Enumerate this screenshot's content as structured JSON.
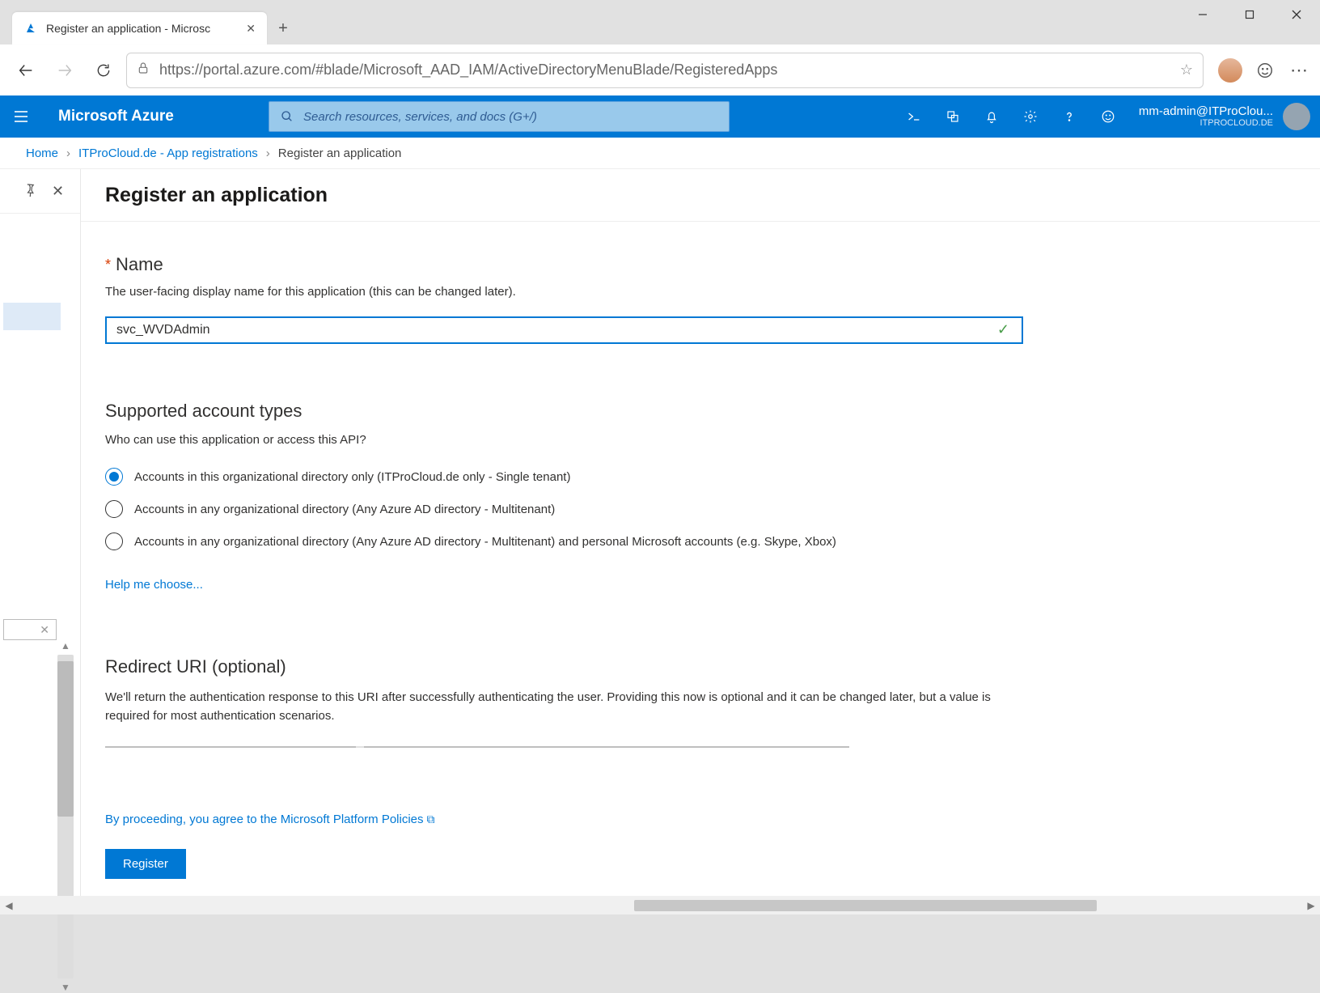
{
  "browser": {
    "tab_title": "Register an application - Microsc",
    "url": "https://portal.azure.com/#blade/Microsoft_AAD_IAM/ActiveDirectoryMenuBlade/RegisteredApps"
  },
  "azure": {
    "brand": "Microsoft Azure",
    "search_placeholder": "Search resources, services, and docs (G+/)",
    "user_line1": "mm-admin@ITProClou...",
    "user_line2": "ITPROCLOUD.DE"
  },
  "breadcrumb": {
    "items": [
      "Home",
      "ITProCloud.de - App registrations",
      "Register an application"
    ]
  },
  "page": {
    "title": "Register an application",
    "name_section": {
      "label": "Name",
      "desc": "The user-facing display name for this application (this can be changed later).",
      "value": "svc_WVDAdmin"
    },
    "account_types": {
      "label": "Supported account types",
      "desc": "Who can use this application or access this API?",
      "options": [
        "Accounts in this organizational directory only (ITProCloud.de only - Single tenant)",
        "Accounts in any organizational directory (Any Azure AD directory - Multitenant)",
        "Accounts in any organizational directory (Any Azure AD directory - Multitenant) and personal Microsoft accounts (e.g. Skype, Xbox)"
      ],
      "help_link": "Help me choose..."
    },
    "redirect": {
      "label": "Redirect URI (optional)",
      "desc": "We'll return the authentication response to this URI after successfully authenticating the user. Providing this now is optional and it can be changed later, but a value is required for most authentication scenarios."
    },
    "policy_text": "By proceeding, you agree to the Microsoft Platform Policies",
    "register_label": "Register"
  }
}
